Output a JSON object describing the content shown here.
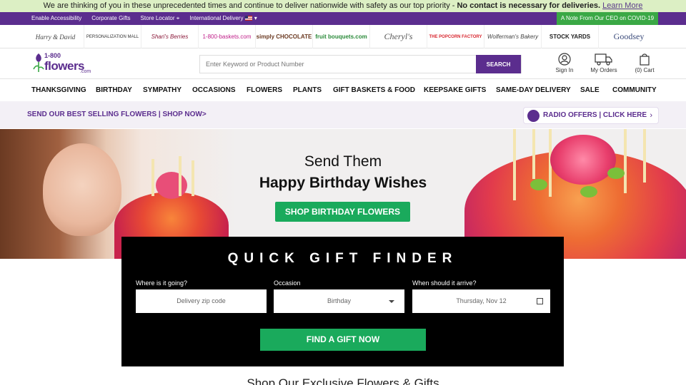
{
  "notice": {
    "text": "We are thinking of you in these unprecedented times and continue to deliver nationwide with safety as our top priority -",
    "bold": "No contact is necessary for deliveries.",
    "link": "Learn More"
  },
  "utility": {
    "links": [
      "Enable Accessibility",
      "Corporate Gifts",
      "Store Locator",
      "International Delivery"
    ],
    "covid": "A Note From Our CEO on COVID-19"
  },
  "brands": [
    "Harry & David",
    "PERSONALIZATION MALL",
    "Shari's Berries",
    "1-800-baskets.com",
    "simply CHOCOLATE",
    "fruit bouquets.com",
    "Cheryl's",
    "THE POPCORN FACTORY",
    "Wolferman's Bakery",
    "STOCK YARDS",
    "Goodsey"
  ],
  "header": {
    "logo_top": "1-800",
    "logo_main": "flowers",
    "logo_suffix": ".com",
    "search_placeholder": "Enter Keyword or Product Number",
    "search_button": "SEARCH",
    "signin": "Sign In",
    "orders": "My Orders",
    "cart": "(0) Cart"
  },
  "nav": [
    "THANKSGIVING",
    "BIRTHDAY",
    "SYMPATHY",
    "OCCASIONS",
    "FLOWERS",
    "PLANTS",
    "GIFT BASKETS & FOOD",
    "KEEPSAKE GIFTS",
    "SAME-DAY DELIVERY",
    "SALE",
    "COMMUNITY"
  ],
  "promo": {
    "left": "SEND OUR BEST SELLING FLOWERS | SHOP NOW>",
    "radio": "RADIO OFFERS | CLICK HERE",
    "chevron": "›"
  },
  "hero": {
    "line1": "Send Them",
    "line2": "Happy Birthday Wishes",
    "cta": "SHOP BIRTHDAY FLOWERS"
  },
  "finder": {
    "title": "QUICK GIFT FINDER",
    "where_label": "Where is it going?",
    "where_placeholder": "Delivery zip code",
    "occasion_label": "Occasion",
    "occasion_value": "Birthday",
    "when_label": "When should it arrive?",
    "when_value": "Thursday, Nov 12",
    "button": "FIND A GIFT NOW"
  },
  "bottom": {
    "text": "Shop Our Exclusive Flowers & Gifts"
  },
  "colors": {
    "brand_purple": "#5b2d8e",
    "cta_green": "#1aaa5c",
    "notice_bg": "#dcefc4"
  }
}
